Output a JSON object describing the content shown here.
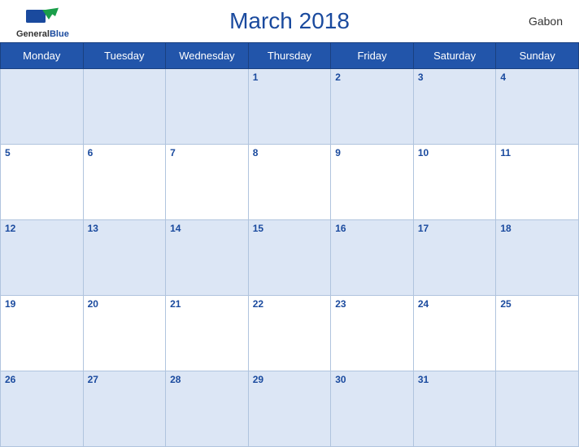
{
  "header": {
    "title": "March 2018",
    "country": "Gabon",
    "logo": {
      "line1": "General",
      "line2": "Blue"
    }
  },
  "weekdays": [
    "Monday",
    "Tuesday",
    "Wednesday",
    "Thursday",
    "Friday",
    "Saturday",
    "Sunday"
  ],
  "weeks": [
    [
      null,
      null,
      null,
      1,
      2,
      3,
      4
    ],
    [
      5,
      6,
      7,
      8,
      9,
      10,
      11
    ],
    [
      12,
      13,
      14,
      15,
      16,
      17,
      18
    ],
    [
      19,
      20,
      21,
      22,
      23,
      24,
      25
    ],
    [
      26,
      27,
      28,
      29,
      30,
      31,
      null
    ]
  ]
}
